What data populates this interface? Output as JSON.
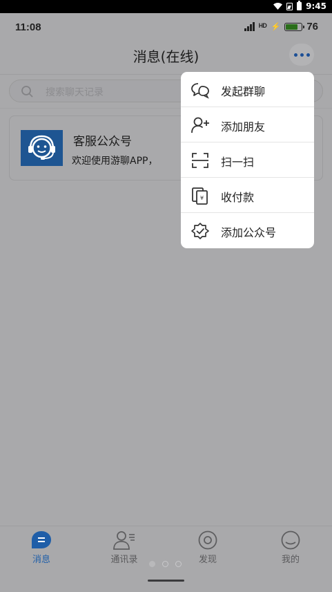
{
  "system_bar": {
    "time": "9:45"
  },
  "status_bar": {
    "time": "11:08",
    "network": "4G",
    "battery": "76"
  },
  "header": {
    "title": "消息(在线)",
    "more_icon": "more-dots-icon"
  },
  "search": {
    "placeholder": "搜索聊天记录"
  },
  "chats": [
    {
      "name": "客服公众号",
      "preview": "欢迎使用游聊APP，",
      "avatar_icon": "customer-service-headset-icon"
    }
  ],
  "menu": {
    "items": [
      {
        "label": "发起群聊",
        "icon": "group-chat-icon"
      },
      {
        "label": "添加朋友",
        "icon": "add-friend-icon"
      },
      {
        "label": "扫一扫",
        "icon": "scan-icon"
      },
      {
        "label": "收付款",
        "icon": "payment-icon"
      },
      {
        "label": "添加公众号",
        "icon": "add-official-account-icon"
      }
    ]
  },
  "tabs": [
    {
      "label": "消息",
      "active": true
    },
    {
      "label": "通讯录",
      "active": false
    },
    {
      "label": "发现",
      "active": false
    },
    {
      "label": "我的",
      "active": false
    }
  ],
  "colors": {
    "accent": "#1f5ea8",
    "overlay": "#a9a9ab",
    "menu_bg": "#ffffff"
  }
}
